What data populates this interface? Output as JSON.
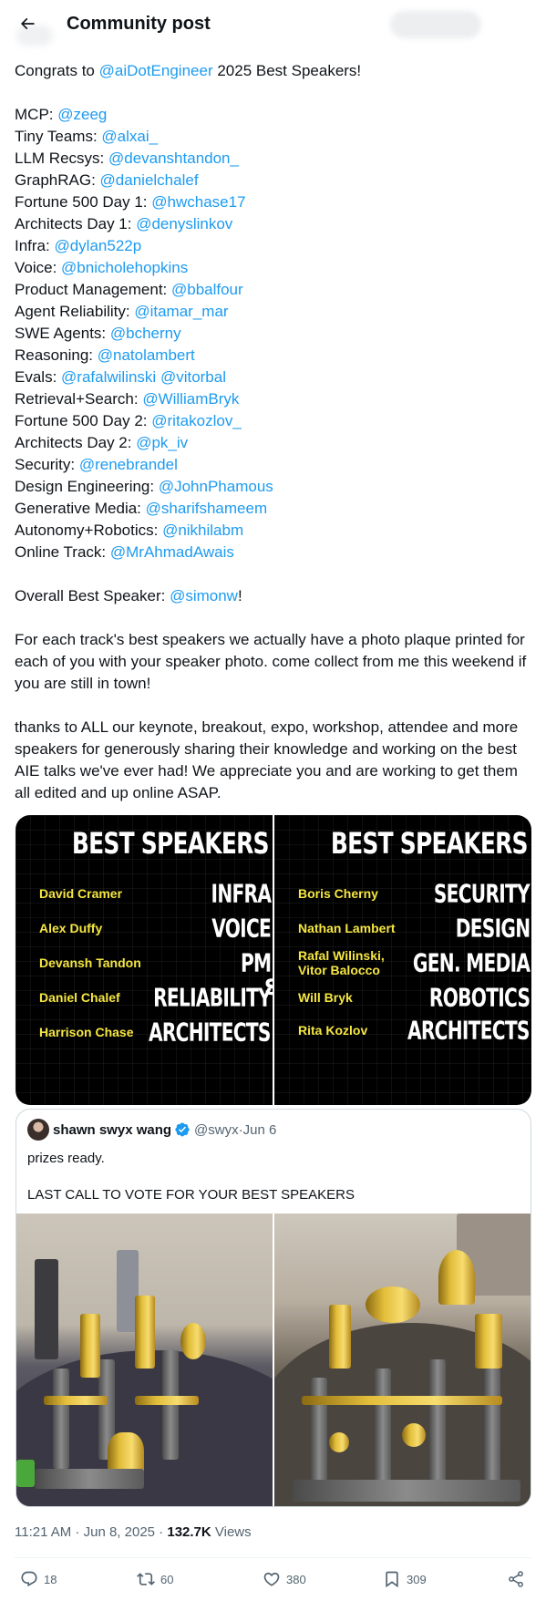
{
  "header": {
    "title": "Community post"
  },
  "post": {
    "intro_prefix": "Congrats to ",
    "intro_mention": "@aiDotEngineer",
    "intro_suffix": " 2025 Best Speakers!",
    "awards": [
      {
        "label": "MCP: ",
        "mentions": [
          "@zeeg"
        ]
      },
      {
        "label": "Tiny Teams: ",
        "mentions": [
          "@alxai_"
        ]
      },
      {
        "label": "LLM Recsys: ",
        "mentions": [
          "@devanshtandon_"
        ]
      },
      {
        "label": "GraphRAG: ",
        "mentions": [
          "@danielchalef"
        ]
      },
      {
        "label": "Fortune 500 Day 1: ",
        "mentions": [
          "@hwchase17"
        ]
      },
      {
        "label": "Architects Day 1:  ",
        "mentions": [
          "@denyslinkov"
        ]
      },
      {
        "label": "Infra: ",
        "mentions": [
          "@dylan522p"
        ]
      },
      {
        "label": "Voice: ",
        "mentions": [
          "@bnicholehopkins"
        ]
      },
      {
        "label": "Product Management: ",
        "mentions": [
          "@bbalfour"
        ]
      },
      {
        "label": "Agent Reliability: ",
        "mentions": [
          "@itamar_mar"
        ]
      },
      {
        "label": "SWE Agents: ",
        "mentions": [
          "@bcherny"
        ]
      },
      {
        "label": "Reasoning: ",
        "mentions": [
          "@natolambert"
        ]
      },
      {
        "label": "Evals: ",
        "mentions": [
          "@rafalwilinski",
          "@vitorbal"
        ]
      },
      {
        "label": "Retrieval+Search: ",
        "mentions": [
          "@WilliamBryk"
        ]
      },
      {
        "label": "Fortune 500 Day 2: ",
        "mentions": [
          "@ritakozlov_"
        ]
      },
      {
        "label": "Architects Day 2: ",
        "mentions": [
          "@pk_iv"
        ]
      },
      {
        "label": "Security: ",
        "mentions": [
          "@renebrandel"
        ]
      },
      {
        "label": "Design Engineering: ",
        "mentions": [
          "@JohnPhamous"
        ]
      },
      {
        "label": "Generative Media: ",
        "mentions": [
          "@sharifshameem"
        ]
      },
      {
        "label": "Autonomy+Robotics: ",
        "mentions": [
          "@nikhilabm"
        ]
      },
      {
        "label": "Online Track:  ",
        "mentions": [
          "@MrAhmadAwais"
        ]
      }
    ],
    "overall_prefix": "Overall Best Speaker: ",
    "overall_mention": "@simonw",
    "overall_suffix": "!",
    "paragraph1": "For each track's best speakers we actually have a photo plaque printed for each of you with your speaker photo. come collect from me this weekend if you are still in town!",
    "paragraph2": "thanks to ALL our keynote, breakout, expo, workshop, attendee and more speakers for generously sharing their knowledge and working on the best AIE talks we've ever had! We appreciate you and are working to get them all edited and up online ASAP."
  },
  "speaker_images": [
    {
      "title": "BEST SPEAKERS",
      "rows": [
        {
          "name": "David Cramer",
          "track": "INFRA"
        },
        {
          "name": "Alex Duffy",
          "track": "VOICE"
        },
        {
          "name": "Devansh Tandon",
          "track": "PM"
        },
        {
          "name": "Daniel Chalef",
          "track": "RELIABILITY"
        },
        {
          "name": "Harrison Chase",
          "track": "ARCHITECTS"
        }
      ]
    },
    {
      "title": "BEST SPEAKERS",
      "rows": [
        {
          "name": "Boris Cherny",
          "track": "SECURITY"
        },
        {
          "name": "Nathan Lambert",
          "track": "DESIGN"
        },
        {
          "name": "Rafal Wilinski,\nVitor Balocco",
          "track": "GEN. MEDIA"
        },
        {
          "name": "Will Bryk",
          "track": "ROBOTICS"
        },
        {
          "name": "Rita Kozlov",
          "track": "ARCHITECTS"
        }
      ]
    }
  ],
  "quoted_post": {
    "author_name": "shawn swyx wang",
    "handle": "@swyx",
    "separator": " · ",
    "date": "Jun 6",
    "text_line1": "prizes ready.",
    "text_line2": "LAST CALL TO VOTE FOR YOUR BEST SPEAKERS"
  },
  "meta": {
    "time": "11:21 AM",
    "separator": " · ",
    "date": "Jun 8, 2025",
    "views_count": "132.7K",
    "views_label": " Views"
  },
  "actions": {
    "replies": "18",
    "reposts": "60",
    "likes": "380",
    "bookmarks": "309"
  },
  "colors": {
    "accent": "#1d9bf0",
    "text": "#0f1419",
    "secondary": "#536471",
    "plaque_name": "#f5e642"
  }
}
